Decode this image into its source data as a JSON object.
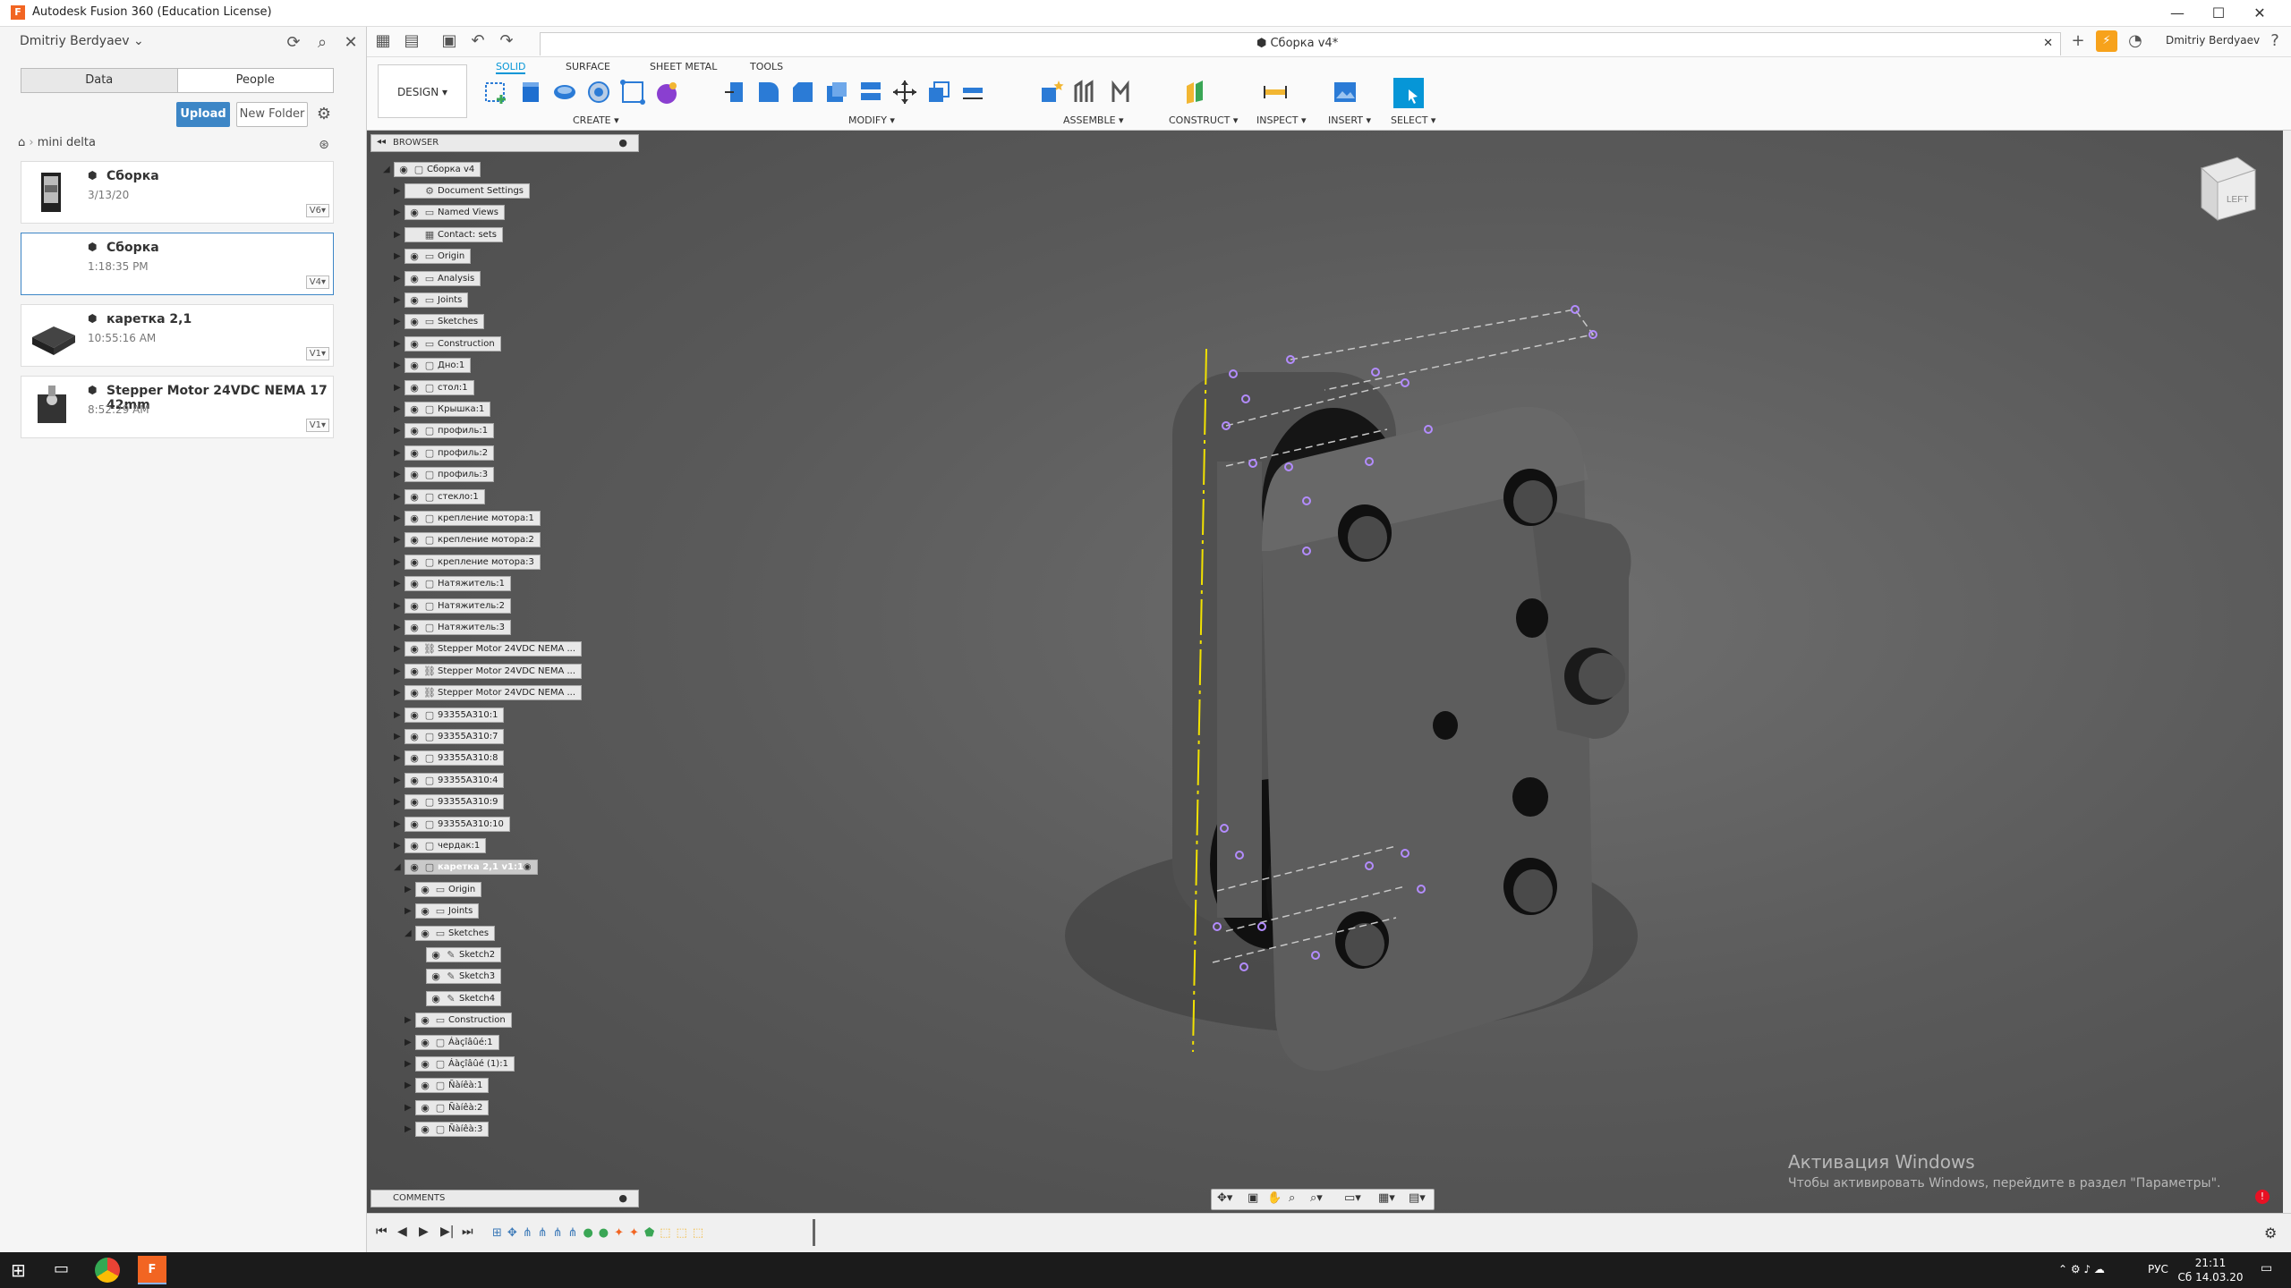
{
  "window": {
    "title": "Autodesk Fusion 360 (Education License)",
    "minimize": "—",
    "maximize": "☐",
    "close": "✕"
  },
  "user": {
    "name": "Dmitriy Berdyaev"
  },
  "data_panel": {
    "tabs": [
      "Data",
      "People"
    ],
    "upload": "Upload",
    "new_folder": "New Folder",
    "breadcrumb": "mini delta",
    "items": [
      {
        "name": "Сборка",
        "date": "3/13/20",
        "version": "V6"
      },
      {
        "name": "Сборка",
        "date": "1:18:35 PM",
        "version": "V4"
      },
      {
        "name": "каретка 2,1",
        "date": "10:55:16 AM",
        "version": "V1"
      },
      {
        "name": "Stepper Motor 24VDC NEMA 17 42mm",
        "date": "8:52:29 AM",
        "version": "V1"
      }
    ]
  },
  "document": {
    "tab_title": "Сборка v4*",
    "account": "Dmitriy Berdyaev"
  },
  "ribbon": {
    "workspace": "DESIGN",
    "tabs": [
      "SOLID",
      "SURFACE",
      "SHEET METAL",
      "TOOLS"
    ],
    "groups": [
      "CREATE",
      "MODIFY",
      "ASSEMBLE",
      "CONSTRUCT",
      "INSPECT",
      "INSERT",
      "SELECT"
    ]
  },
  "browser": {
    "title": "BROWSER",
    "root": "Сборка v4",
    "items": [
      {
        "label": "Document Settings",
        "icon": "gear",
        "level": 1
      },
      {
        "label": "Named Views",
        "icon": "folder",
        "level": 1
      },
      {
        "label": "Contact: sets",
        "icon": "contact",
        "level": 1
      },
      {
        "label": "Origin",
        "icon": "folder",
        "level": 1
      },
      {
        "label": "Analysis",
        "icon": "folder",
        "level": 1
      },
      {
        "label": "Joints",
        "icon": "folder",
        "level": 1
      },
      {
        "label": "Sketches",
        "icon": "folder",
        "level": 1
      },
      {
        "label": "Construction",
        "icon": "folder",
        "level": 1
      },
      {
        "label": "Дно:1",
        "icon": "component",
        "level": 1
      },
      {
        "label": "стол:1",
        "icon": "component",
        "level": 1
      },
      {
        "label": "Крышка:1",
        "icon": "component",
        "level": 1
      },
      {
        "label": "профиль:1",
        "icon": "component",
        "level": 1
      },
      {
        "label": "профиль:2",
        "icon": "component",
        "level": 1
      },
      {
        "label": "профиль:3",
        "icon": "component",
        "level": 1
      },
      {
        "label": "стекло:1",
        "icon": "component",
        "level": 1
      },
      {
        "label": "крепление мотора:1",
        "icon": "component",
        "level": 1
      },
      {
        "label": "крепление мотора:2",
        "icon": "component",
        "level": 1
      },
      {
        "label": "крепление мотора:3",
        "icon": "component",
        "level": 1
      },
      {
        "label": "Натяжитель:1",
        "icon": "component",
        "level": 1
      },
      {
        "label": "Натяжитель:2",
        "icon": "component",
        "level": 1
      },
      {
        "label": "Натяжитель:3",
        "icon": "component",
        "level": 1
      },
      {
        "label": "Stepper Motor 24VDC NEMA ...",
        "icon": "link",
        "level": 1
      },
      {
        "label": "Stepper Motor 24VDC NEMA ...",
        "icon": "link",
        "level": 1
      },
      {
        "label": "Stepper Motor 24VDC NEMA ...",
        "icon": "link",
        "level": 1
      },
      {
        "label": "93355A310:1",
        "icon": "component",
        "level": 1
      },
      {
        "label": "93355A310:7",
        "icon": "component",
        "level": 1
      },
      {
        "label": "93355A310:8",
        "icon": "component",
        "level": 1
      },
      {
        "label": "93355A310:4",
        "icon": "component",
        "level": 1
      },
      {
        "label": "93355A310:9",
        "icon": "component",
        "level": 1
      },
      {
        "label": "93355A310:10",
        "icon": "component",
        "level": 1
      },
      {
        "label": "чердак:1",
        "icon": "component",
        "level": 1
      },
      {
        "label": "каретка 2,1 v1:1",
        "icon": "component",
        "level": 1,
        "active": true
      },
      {
        "label": "Origin",
        "icon": "folder",
        "level": 2
      },
      {
        "label": "Joints",
        "icon": "folder",
        "level": 2
      },
      {
        "label": "Sketches",
        "icon": "folder",
        "level": 2
      },
      {
        "label": "Sketch2",
        "icon": "sketch",
        "level": 3
      },
      {
        "label": "Sketch3",
        "icon": "sketch",
        "level": 3
      },
      {
        "label": "Sketch4",
        "icon": "sketch",
        "level": 3
      },
      {
        "label": "Construction",
        "icon": "folder",
        "level": 2
      },
      {
        "label": "Áàçîâûé:1",
        "icon": "component",
        "level": 2
      },
      {
        "label": "Áàçîâûé (1):1",
        "icon": "component",
        "level": 2
      },
      {
        "label": "Ñàíêà:1",
        "icon": "component",
        "level": 2
      },
      {
        "label": "Ñàíêà:2",
        "icon": "component",
        "level": 2
      },
      {
        "label": "Ñàíêà:3",
        "icon": "component",
        "level": 2
      }
    ]
  },
  "comments": {
    "title": "COMMENTS"
  },
  "viewcube": {
    "face": "LEFT"
  },
  "watermark": {
    "line1": "Активация Windows",
    "line2": "Чтобы активировать Windows, перейдите в раздел \"Параметры\"."
  },
  "taskbar": {
    "lang": "РУС",
    "time": "21:11",
    "date": "Сб 14.03.20"
  }
}
